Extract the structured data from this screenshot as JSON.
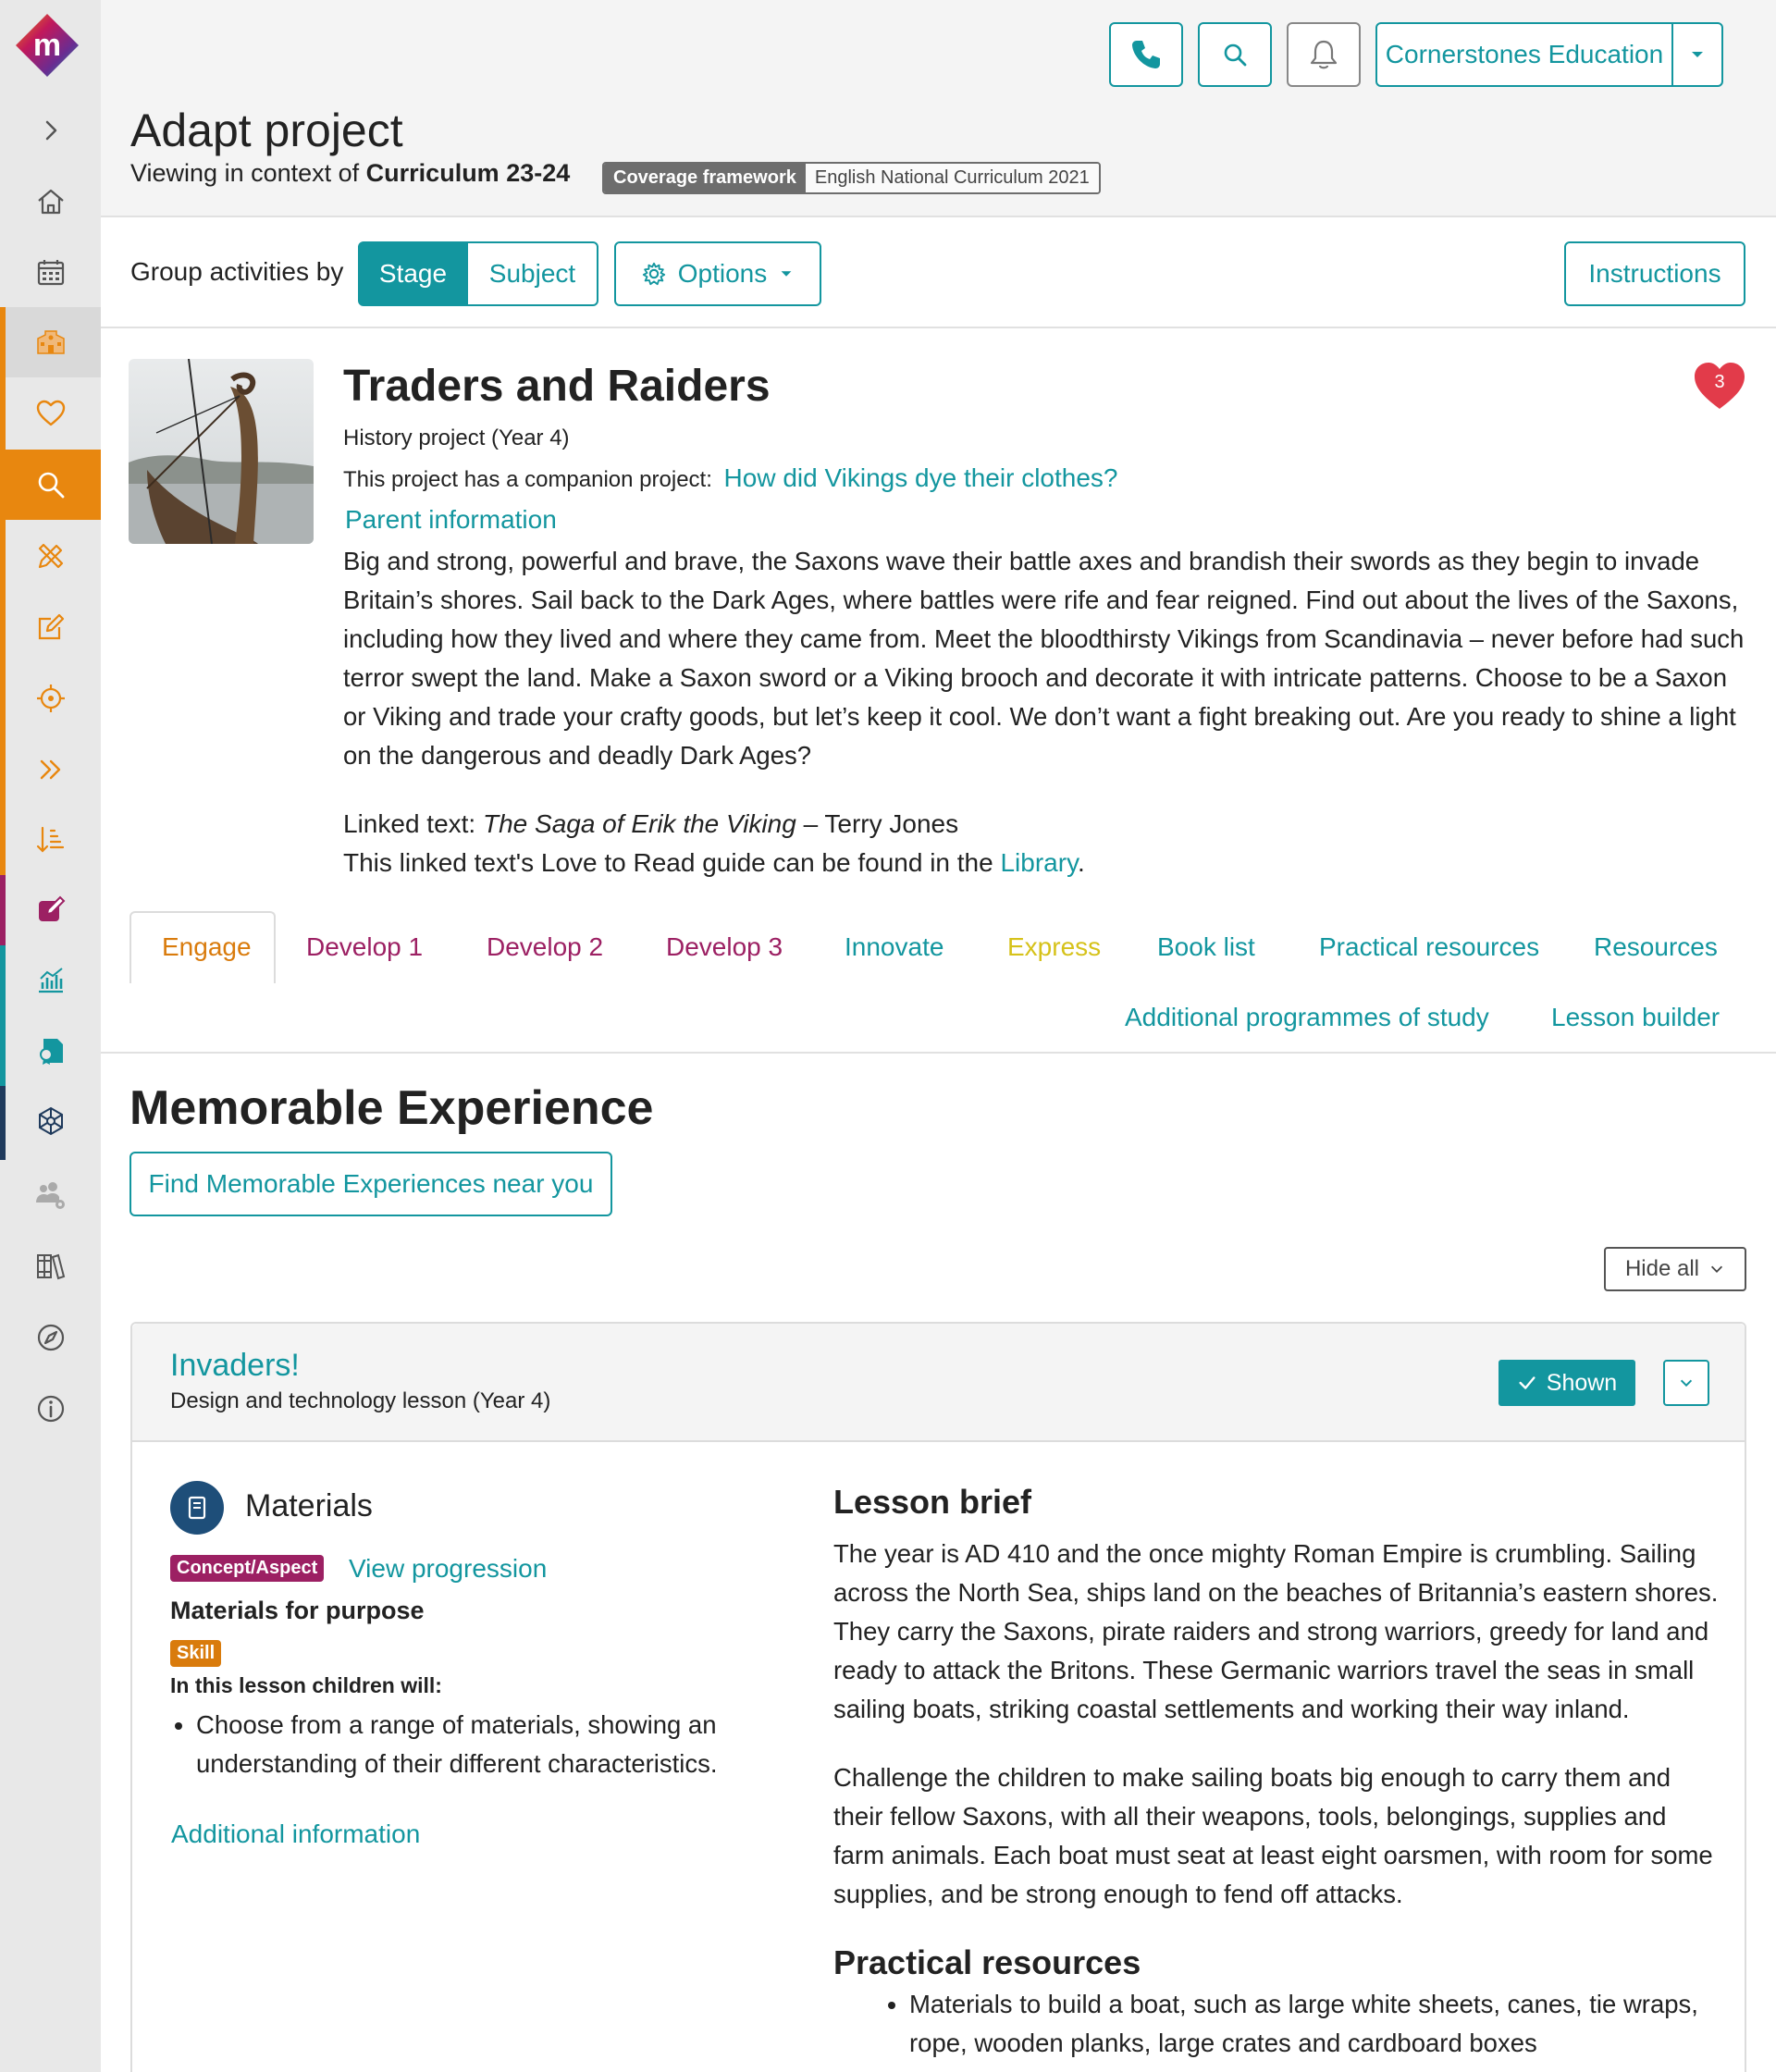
{
  "sidebar": {
    "logo_letter": "m",
    "items": [
      {
        "icon": "chevron-right-icon"
      },
      {
        "icon": "home-icon"
      },
      {
        "icon": "calendar-icon"
      },
      {
        "icon": "school-icon"
      },
      {
        "icon": "heart-icon"
      },
      {
        "icon": "search-icon"
      },
      {
        "icon": "pencil-ruler-icon"
      },
      {
        "icon": "edit-icon"
      },
      {
        "icon": "target-icon"
      },
      {
        "icon": "double-chevron-icon"
      },
      {
        "icon": "sort-icon"
      },
      {
        "icon": "pen-square-icon"
      },
      {
        "icon": "chart-icon"
      },
      {
        "icon": "certificate-icon"
      },
      {
        "icon": "network-icon"
      },
      {
        "icon": "users-cog-icon"
      },
      {
        "icon": "books-icon"
      },
      {
        "icon": "compass-icon"
      },
      {
        "icon": "info-icon"
      }
    ],
    "colors": {
      "orange": "#e8870f",
      "purple": "#9c2063",
      "teal": "#13969f",
      "navy": "#1f3a5c"
    }
  },
  "header": {
    "org_name": "Cornerstones Education",
    "page_title": "Adapt project",
    "context_prefix": "Viewing in context of",
    "context_value": "Curriculum 23-24",
    "coverage_label": "Coverage framework",
    "coverage_value": "English National Curriculum 2021"
  },
  "toolbar": {
    "group_label": "Group activities by",
    "stage": "Stage",
    "subject": "Subject",
    "options": "Options",
    "instructions": "Instructions"
  },
  "project": {
    "title": "Traders and Raiders",
    "subtitle": "History project (Year 4)",
    "companion_prefix": "This project has a companion project:",
    "companion_link": "How did Vikings dye their clothes?",
    "parent_info": "Parent information",
    "description": "Big and strong, powerful and brave, the Saxons wave their battle axes and brandish their swords as they begin to invade Britain’s shores. Sail back to the Dark Ages, where battles were rife and fear reigned. Find out about the lives of the Saxons, including how they lived and where they came from. Meet the bloodthirsty Vikings from Scandinavia – never before had such terror swept the land. Make a Saxon sword or a Viking brooch and decorate it with intricate patterns. Choose to be a Saxon or Viking and trade your crafty goods, but let’s keep it cool. We don’t want a fight breaking out. Are you ready to shine a light on the dangerous and deadly Dark Ages?",
    "linked_prefix": "Linked text:",
    "linked_title": "The Saga of Erik the Viking",
    "linked_author": "– Terry Jones",
    "guide_prefix": "This linked text's Love to Read guide can be found in the",
    "guide_link": "Library",
    "guide_suffix": ".",
    "favourite_count": "3"
  },
  "tabs": [
    {
      "label": "Engage",
      "color": "#d97b0c"
    },
    {
      "label": "Develop 1",
      "color": "#9c2063"
    },
    {
      "label": "Develop 2",
      "color": "#9c2063"
    },
    {
      "label": "Develop 3",
      "color": "#9c2063"
    },
    {
      "label": "Innovate",
      "color": "#13969f"
    },
    {
      "label": "Express",
      "color": "#d6c21a"
    },
    {
      "label": "Book list",
      "color": "#13969f"
    },
    {
      "label": "Practical resources",
      "color": "#13969f"
    },
    {
      "label": "Resources",
      "color": "#13969f"
    },
    {
      "label": "Additional programmes of study",
      "color": "#13969f"
    },
    {
      "label": "Lesson builder",
      "color": "#13969f"
    }
  ],
  "section": {
    "title": "Memorable Experience",
    "find_button": "Find Memorable Experiences near you",
    "hide_all": "Hide all"
  },
  "lesson": {
    "title": "Invaders!",
    "subtitle": "Design and technology lesson (Year 4)",
    "shown": "Shown",
    "materials_title": "Materials",
    "concept_badge": "Concept/Aspect",
    "view_progression": "View progression",
    "materials_for_purpose": "Materials for purpose",
    "skill_badge": "Skill",
    "in_this_lesson": "In this lesson children will:",
    "objectives": [
      "Choose from a range of materials, showing an understanding of their different characteristics."
    ],
    "additional_info": "Additional information",
    "brief_title": "Lesson brief",
    "brief_p1": "The year is AD 410 and the once mighty Roman Empire is crumbling. Sailing across the North Sea, ships land on the beaches of Britannia’s eastern shores. They carry the Saxons, pirate raiders and strong warriors, greedy for land and ready to attack the Britons. These Germanic warriors travel the seas in small sailing boats, striking coastal settlements and working their way inland.",
    "brief_p2": "Challenge the children to make sailing boats big enough to carry them and their fellow Saxons, with all their weapons, tools, belongings, supplies and farm animals. Each boat must seat at least eight oarsmen, with room for some supplies, and be strong enough to fend off attacks.",
    "practical_title": "Practical resources",
    "practical_items": [
      "Materials to build a boat, such as large white sheets, canes, tie wraps, rope, wooden planks, large crates and cardboard boxes"
    ]
  },
  "colors": {
    "accent": "#13969f",
    "concept": "#9c2063",
    "skill": "#d97b0c",
    "heart": "#e23b4a"
  }
}
